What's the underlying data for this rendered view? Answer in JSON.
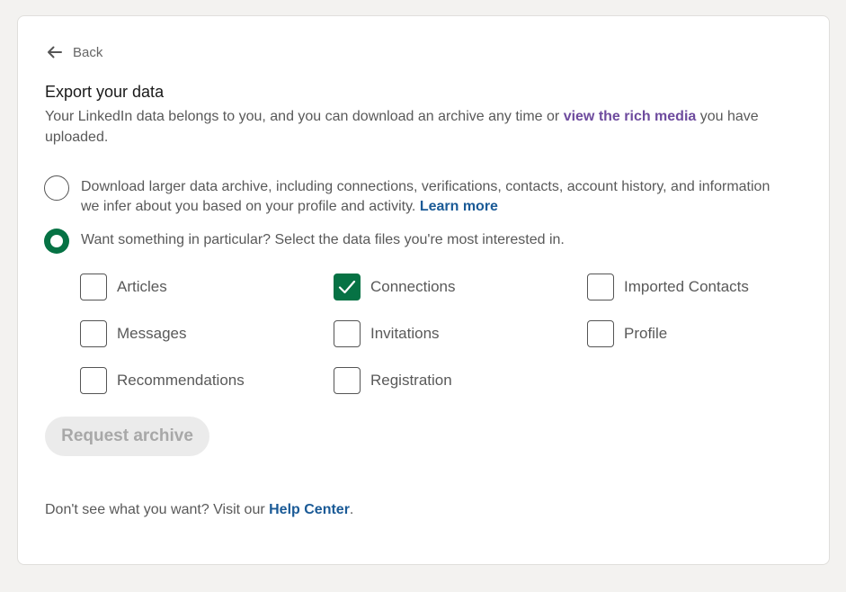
{
  "back": {
    "label": "Back"
  },
  "page": {
    "title": "Export your data",
    "desc_before": "Your LinkedIn data belongs to you, and you can download an archive any time or ",
    "desc_link": "view the rich media",
    "desc_after": " you have uploaded."
  },
  "options": {
    "large": {
      "text": "Download larger data archive, including connections, verifications, contacts, account history, and information we infer about you based on your profile and activity. ",
      "link": "Learn more",
      "selected": false
    },
    "particular": {
      "text": "Want something in particular? Select the data files you're most interested in.",
      "selected": true
    }
  },
  "files": [
    {
      "label": "Articles",
      "checked": false
    },
    {
      "label": "Connections",
      "checked": true
    },
    {
      "label": "Imported Contacts",
      "checked": false
    },
    {
      "label": "Messages",
      "checked": false
    },
    {
      "label": "Invitations",
      "checked": false
    },
    {
      "label": "Profile",
      "checked": false
    },
    {
      "label": "Recommendations",
      "checked": false
    },
    {
      "label": "Registration",
      "checked": false
    }
  ],
  "actions": {
    "request_label": "Request archive"
  },
  "footer": {
    "text_before": "Don't see what you want? Visit our ",
    "link": "Help Center",
    "text_after": "."
  },
  "colors": {
    "accent_green": "#067244",
    "link_blue": "#1a5a96",
    "link_purple": "#6e4b9e"
  }
}
